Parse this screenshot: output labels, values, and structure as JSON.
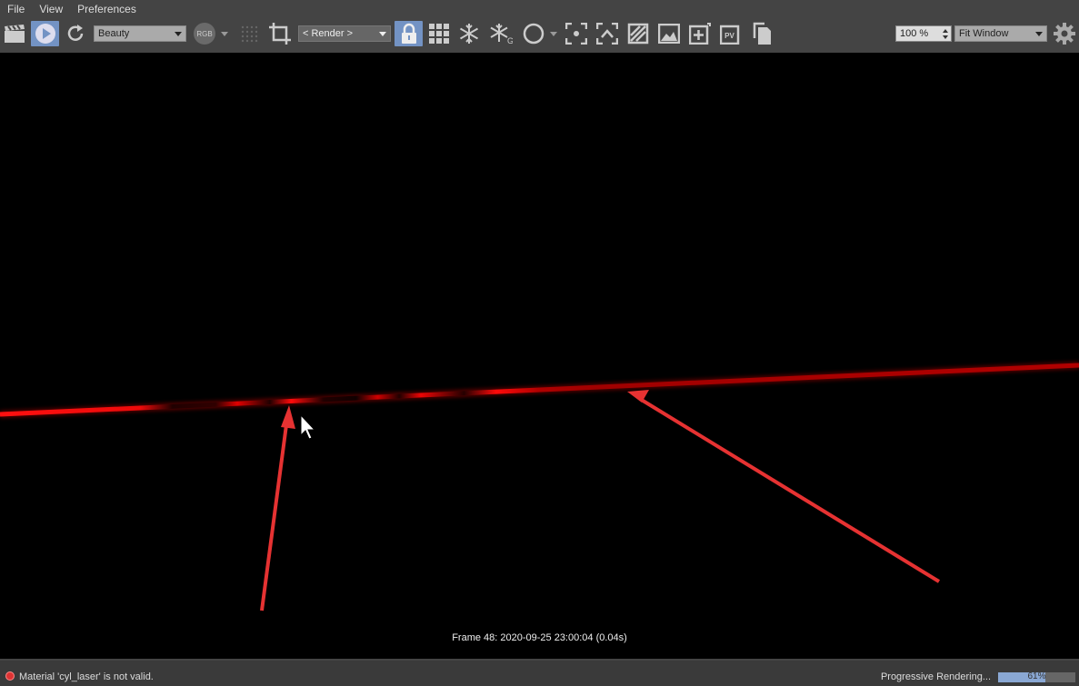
{
  "menu": [
    "File",
    "View",
    "Preferences"
  ],
  "toolbar": {
    "render_pass": "Beauty",
    "channel_badge": "RGB",
    "region": "< Render >",
    "pv_badge": "PV",
    "zoom": "100 %",
    "fit": "Fit Window"
  },
  "icons": [
    "clapper-icon",
    "play-icon",
    "refresh-icon",
    "rgb-icon",
    "grid-dots-icon",
    "crop-icon",
    "lock-icon",
    "grid-icon",
    "snowflake-icon",
    "snowflake-g-icon",
    "circle-icon",
    "focus-icon",
    "expand-icon",
    "compare-icon",
    "image-icon",
    "add-image-icon",
    "pv-icon",
    "copy-icon",
    "gear-icon"
  ],
  "viewport": {
    "frame_info": "Frame  48:  2020-09-25  23:00:04  (0.04s)"
  },
  "colors": {
    "laser": "#e00000",
    "arrow": "#e63232",
    "accent": "#7393c4"
  },
  "status": {
    "message": "Material 'cyl_laser' is not valid.",
    "progress_label": "Progressive Rendering...",
    "progress_percent": "61%",
    "progress_value": 61
  }
}
